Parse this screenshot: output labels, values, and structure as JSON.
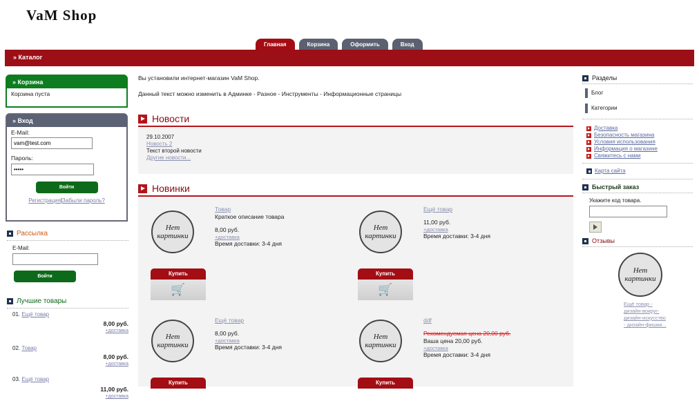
{
  "logo": "VaM Shop",
  "tabs": [
    {
      "label": "Главная",
      "active": true
    },
    {
      "label": "Корзина",
      "active": false
    },
    {
      "label": "Оформить",
      "active": false
    },
    {
      "label": "Вход",
      "active": false
    }
  ],
  "topbar": {
    "label": "» Каталог"
  },
  "cart": {
    "title": "» Корзина",
    "status": "Корзина пуста"
  },
  "login": {
    "title": "» Вход",
    "email_label": "E-Mail:",
    "email_value": "vam@test.com",
    "password_label": "Пароль:",
    "password_value": "•••••",
    "button": "Войти",
    "register_link": "Регистрация",
    "separator": "|",
    "forgot_link": "Забыли пароль?"
  },
  "newsletter": {
    "title": "Рассылка",
    "email_label": "E-Mail:",
    "email_value": "",
    "button": "Войти"
  },
  "best": {
    "title": "Лучшие товары",
    "items": [
      {
        "num": "01.",
        "name": "Ещё товар",
        "price": "8,00 руб.",
        "shipping": "+доставка"
      },
      {
        "num": "02.",
        "name": "Товар",
        "price": "8,00 руб.",
        "shipping": "+доставка"
      },
      {
        "num": "03.",
        "name": "Ещё товар",
        "price": "11,00 руб.",
        "shipping": "+доставка"
      }
    ]
  },
  "intro": {
    "line1": "Вы установили интернет-магазин VaM Shop.",
    "line2": "Данный текст можно изменить в Админке - Разное - Инструменты - Информационные страницы"
  },
  "news": {
    "title": "Новости",
    "date": "29.10.2007",
    "item_link": "Новость 2",
    "item_text": "Текст второй новости",
    "more_link": "Другие новости..."
  },
  "new_products": {
    "title": "Новинки",
    "no_image": [
      "Нет",
      "картинки"
    ],
    "buy_label": "Купить",
    "items": [
      {
        "name": "Товар",
        "desc": "Краткое описание товара",
        "price": "8,00 руб.",
        "old_price": "",
        "shipping": "+доставка",
        "delivery": "Время доставки:  3-4 дня"
      },
      {
        "name": "Ещё товар",
        "desc": "",
        "price": "11,00 руб.",
        "old_price": "",
        "shipping": "+доставка",
        "delivery": "Время доставки:  3-4 дня"
      },
      {
        "name": "Ещё товар",
        "desc": "",
        "price": "8,00 руб.",
        "old_price": "",
        "shipping": "+доставка",
        "delivery": "Время доставки:  3-4 дня"
      },
      {
        "name": "ddf",
        "desc": "",
        "price": "Ваша цена 20,00 руб.",
        "old_price": "Рекомендуемая цена 20,00 руб.",
        "shipping": "+доставка",
        "delivery": "Время доставки:  3-4 дня"
      }
    ]
  },
  "sections": {
    "title": "Разделы",
    "items": [
      "Блог",
      "Категории"
    ]
  },
  "info_links": [
    "Доставка",
    "Безопасность магазина",
    "Условия использования",
    "Информация о магазине",
    "Свяжитесь с нами"
  ],
  "sitemap": "Карта сайта",
  "quick_order": {
    "title": "Быстрый заказ",
    "label": "Укажите код товара.",
    "value": ""
  },
  "reviews": {
    "title": "Отзывы",
    "text": "Ещё товар - дизайн-вокруг-дизайн-искусство - дизайн-фишки..."
  },
  "colors": {
    "brand_red": "#9c0f16",
    "green": "#0d7d1f",
    "tab_gray": "#5b6170"
  }
}
